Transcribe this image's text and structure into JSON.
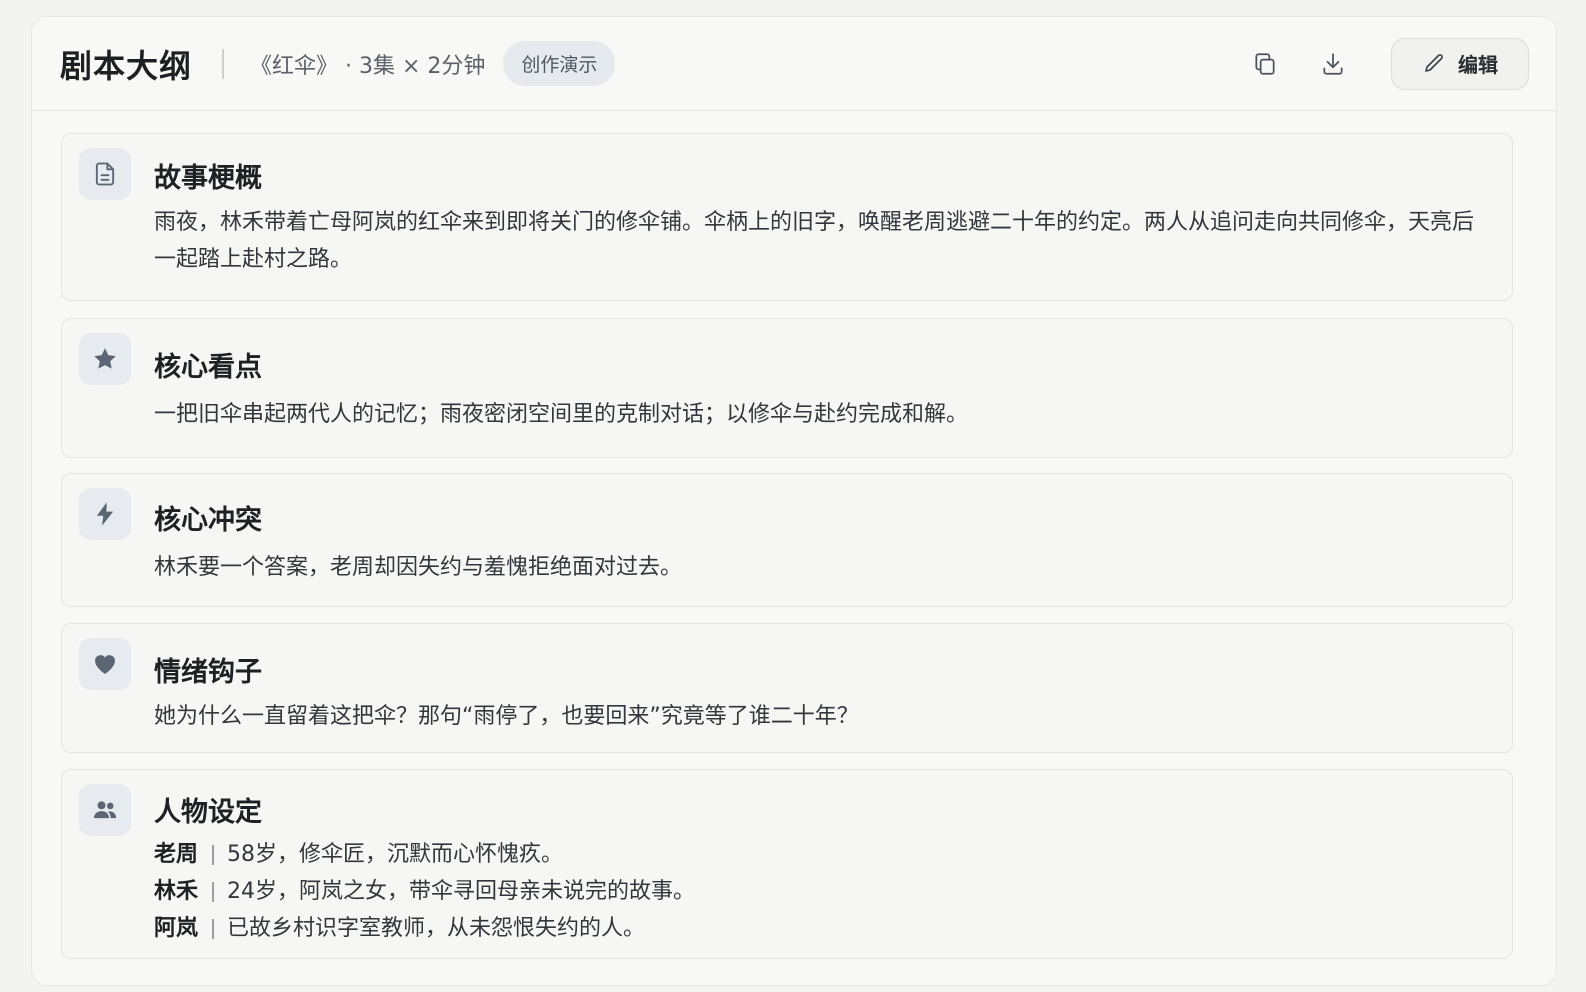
{
  "header": {
    "title": "剧本大纲",
    "meta": "《红伞》 · 3集 × 2分钟",
    "badge": "创作演示",
    "edit_label": "编辑"
  },
  "icons": {
    "copy": "copy-icon",
    "download": "download-icon",
    "edit": "pencil-icon",
    "synopsis": "document-icon",
    "highlights": "star-icon",
    "conflict": "lightning-icon",
    "hook": "heart-icon",
    "characters": "users-icon"
  },
  "sections": {
    "synopsis": {
      "title": "故事梗概",
      "body": "雨夜，林禾带着亡母阿岚的红伞来到即将关门的修伞铺。伞柄上的旧字，唤醒老周逃避二十年的约定。两人从追问走向共同修伞，天亮后一起踏上赴村之路。"
    },
    "highlights": {
      "title": "核心看点",
      "body": "一把旧伞串起两代人的记忆；雨夜密闭空间里的克制对话；以修伞与赴约完成和解。"
    },
    "conflict": {
      "title": "核心冲突",
      "body": "林禾要一个答案，老周却因失约与羞愧拒绝面对过去。"
    },
    "hook": {
      "title": "情绪钩子",
      "body": "她为什么一直留着这把伞？那句“雨停了，也要回来”究竟等了谁二十年？"
    },
    "characters": {
      "title": "人物设定",
      "list": [
        {
          "name": "老周",
          "desc": "58岁，修伞匠，沉默而心怀愧疚。"
        },
        {
          "name": "林禾",
          "desc": "24岁，阿岚之女，带伞寻回母亲未说完的故事。"
        },
        {
          "name": "阿岚",
          "desc": "已故乡村识字室教师，从未怨恨失约的人。"
        }
      ]
    }
  },
  "colors": {
    "icon": "#5b6573",
    "badge_bg": "#e6eaee",
    "card_bg": "#f6f6f4"
  }
}
